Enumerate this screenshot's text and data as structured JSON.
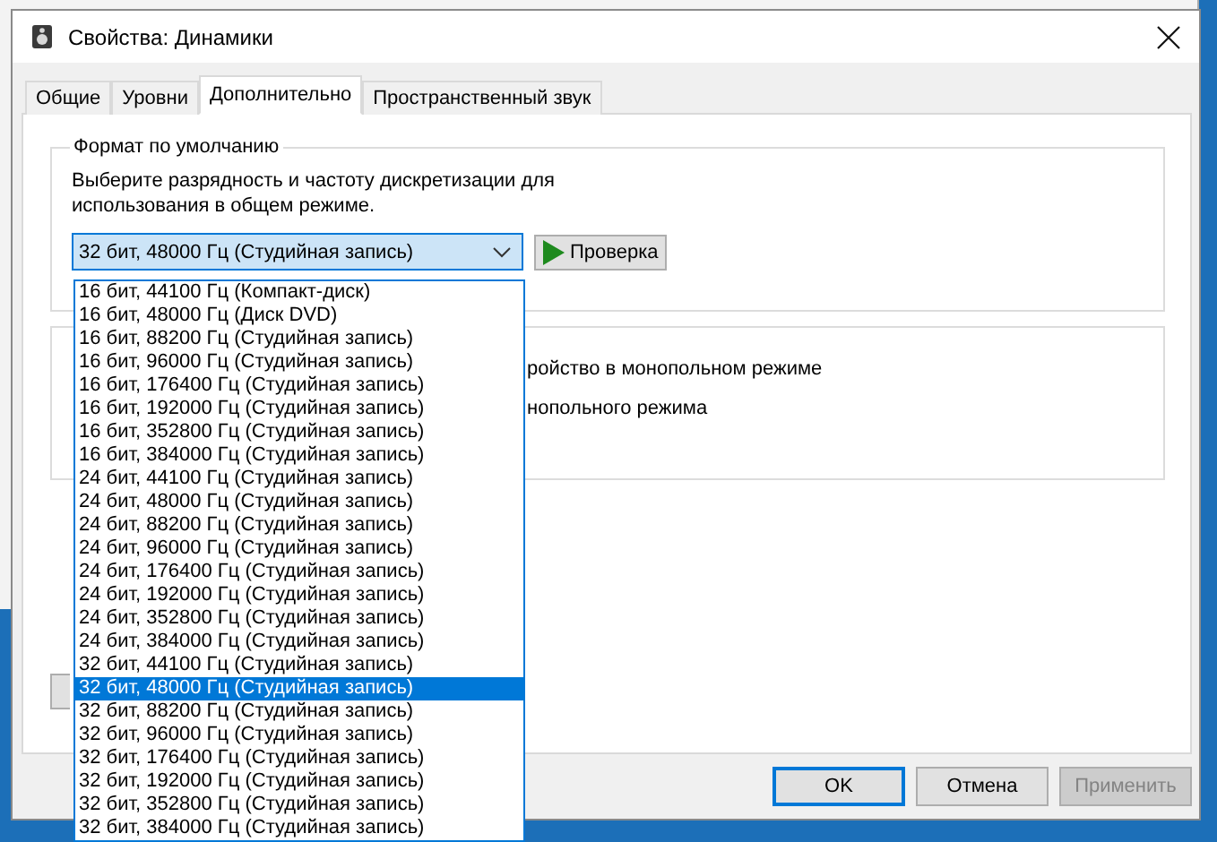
{
  "window": {
    "title": "Свойства: Динамики"
  },
  "tabs": [
    {
      "label": "Общие",
      "selected": false
    },
    {
      "label": "Уровни",
      "selected": false
    },
    {
      "label": "Дополнительно",
      "selected": true
    },
    {
      "label": "Пространственный звук",
      "selected": false
    }
  ],
  "default_format": {
    "title": "Формат по умолчанию",
    "description": "Выберите разрядность и частоту дискретизации для\nиспользования в общем режиме.",
    "format_select": {
      "value": "32 бит, 48000 Гц (Студийная запись)",
      "expanded": true
    },
    "test_button": "Проверка"
  },
  "exclusive_group": {
    "lines": [
      "ройство в монопольном режиме",
      "нопольного режима"
    ]
  },
  "format_options": [
    {
      "label": "16 бит, 44100 Гц (Компакт-диск)",
      "selected": false
    },
    {
      "label": "16 бит, 48000 Гц (Диск DVD)",
      "selected": false
    },
    {
      "label": "16 бит, 88200 Гц (Студийная запись)",
      "selected": false
    },
    {
      "label": "16 бит, 96000 Гц (Студийная запись)",
      "selected": false
    },
    {
      "label": "16 бит, 176400 Гц (Студийная запись)",
      "selected": false
    },
    {
      "label": "16 бит, 192000 Гц (Студийная запись)",
      "selected": false
    },
    {
      "label": "16 бит, 352800 Гц (Студийная запись)",
      "selected": false
    },
    {
      "label": "16 бит, 384000 Гц (Студийная запись)",
      "selected": false
    },
    {
      "label": "24 бит, 44100 Гц (Студийная запись)",
      "selected": false
    },
    {
      "label": "24 бит, 48000 Гц (Студийная запись)",
      "selected": false
    },
    {
      "label": "24 бит, 88200 Гц (Студийная запись)",
      "selected": false
    },
    {
      "label": "24 бит, 96000 Гц (Студийная запись)",
      "selected": false
    },
    {
      "label": "24 бит, 176400 Гц (Студийная запись)",
      "selected": false
    },
    {
      "label": "24 бит, 192000 Гц (Студийная запись)",
      "selected": false
    },
    {
      "label": "24 бит, 352800 Гц (Студийная запись)",
      "selected": false
    },
    {
      "label": "24 бит, 384000 Гц (Студийная запись)",
      "selected": false
    },
    {
      "label": "32 бит, 44100 Гц (Студийная запись)",
      "selected": false
    },
    {
      "label": "32 бит, 48000 Гц (Студийная запись)",
      "selected": true
    },
    {
      "label": "32 бит, 88200 Гц (Студийная запись)",
      "selected": false
    },
    {
      "label": "32 бит, 96000 Гц (Студийная запись)",
      "selected": false
    },
    {
      "label": "32 бит, 176400 Гц (Студийная запись)",
      "selected": false
    },
    {
      "label": "32 бит, 192000 Гц (Студийная запись)",
      "selected": false
    },
    {
      "label": "32 бит, 352800 Гц (Студийная запись)",
      "selected": false
    },
    {
      "label": "32 бит, 384000 Гц (Студийная запись)",
      "selected": false
    }
  ],
  "buttons": [
    {
      "label": "OK",
      "kind": "default",
      "disabled": false
    },
    {
      "label": "Отмена",
      "kind": "normal",
      "disabled": false
    },
    {
      "label": "Применить",
      "kind": "normal",
      "disabled": true
    }
  ]
}
